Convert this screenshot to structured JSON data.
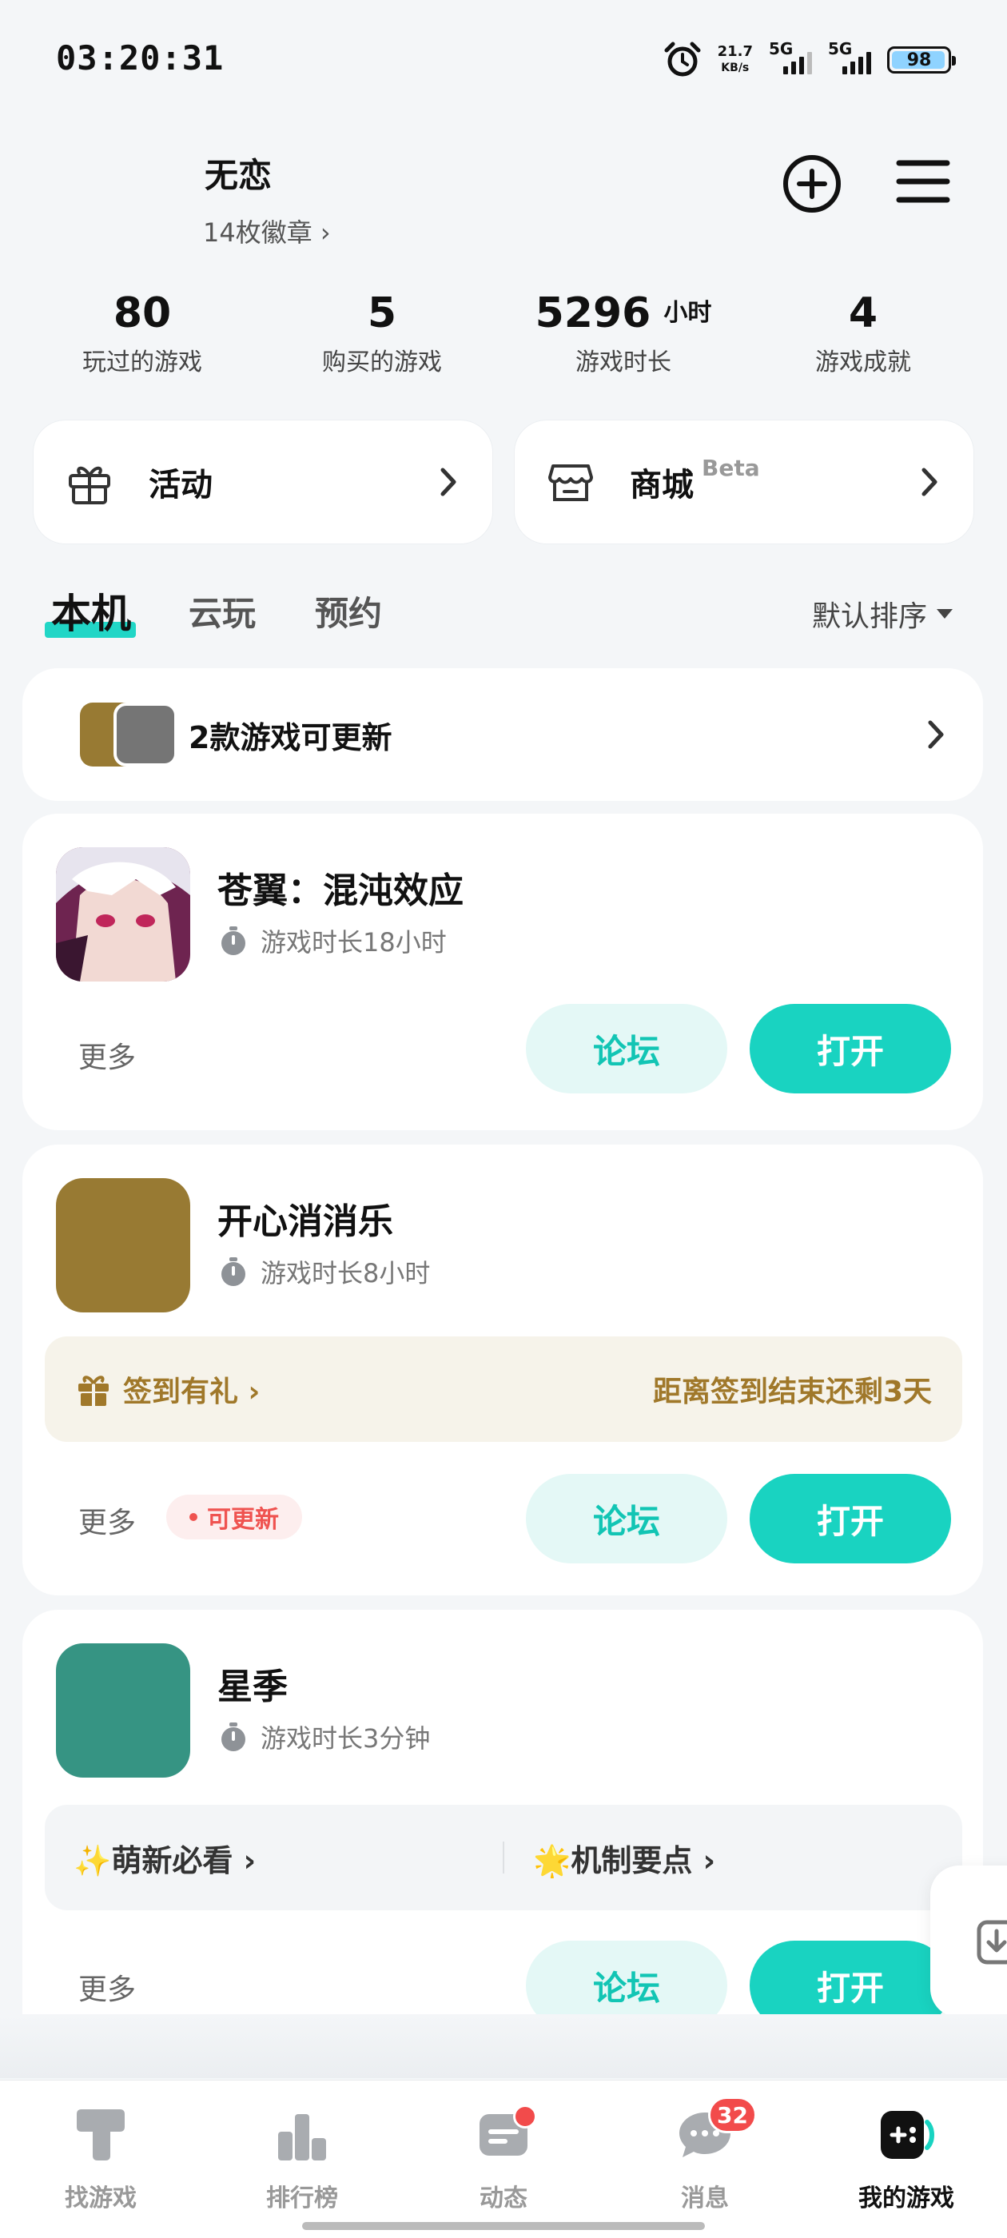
{
  "status_bar": {
    "time": "03:20:31",
    "net_speed_value": "21.7",
    "net_speed_unit": "KB/s",
    "sim1": "5G",
    "sim2": "5G",
    "battery": "98"
  },
  "profile": {
    "username": "无恋",
    "badges_link": "14枚徽章 ›"
  },
  "stats": [
    {
      "value": "80",
      "unit": "",
      "label": "玩过的游戏"
    },
    {
      "value": "5",
      "unit": "",
      "label": "购买的游戏"
    },
    {
      "value": "5296",
      "unit": "小时",
      "label": "游戏时长"
    },
    {
      "value": "4",
      "unit": "",
      "label": "游戏成就"
    }
  ],
  "quick": {
    "activity": "活动",
    "mall": "商城",
    "mall_tag": "Beta"
  },
  "tabs": {
    "local": "本机",
    "cloud": "云玩",
    "reserve": "预约",
    "sort": "默认排序"
  },
  "update_banner": "2款游戏可更新",
  "games": [
    {
      "name": "苍翼：混沌效应",
      "play_time": "游戏时长18小时",
      "more": "更多",
      "forum": "论坛",
      "open": "打开",
      "icon_color": "#7b2a52"
    },
    {
      "name": "开心消消乐",
      "play_time": "游戏时长8小时",
      "checkin_label": "签到有礼 ›",
      "checkin_remaining": "距离签到结束还剩3天",
      "more": "更多",
      "update_badge": "可更新",
      "forum": "论坛",
      "open": "打开",
      "icon_color": "#987a33"
    },
    {
      "name": "星季",
      "play_time": "游戏时长3分钟",
      "guide_1": "✨萌新必看 ›",
      "guide_2": "🌟机制要点 ›",
      "more": "更多",
      "forum": "论坛",
      "open": "打开",
      "icon_color": "#369483"
    }
  ],
  "bottom_nav": [
    {
      "label": "找游戏"
    },
    {
      "label": "排行榜"
    },
    {
      "label": "动态"
    },
    {
      "label": "消息",
      "badge": "32"
    },
    {
      "label": "我的游戏"
    }
  ],
  "colors": {
    "accent": "#19d3c1",
    "accent_light": "#e4f8f6",
    "checkin_text": "#a0782a",
    "badge_red": "#f24b4b"
  }
}
